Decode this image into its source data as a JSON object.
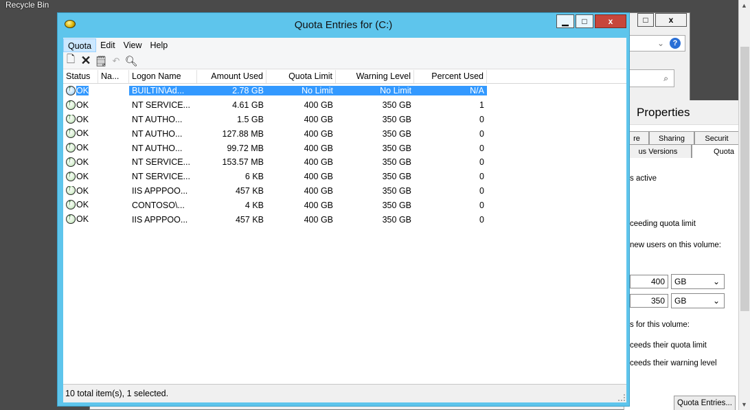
{
  "desktop": {
    "recycle_bin_label": "Recycle Bin"
  },
  "bg_window": {
    "min_label": "–",
    "max_label": "□",
    "close_label": "x",
    "address_dropdown": "⌄",
    "help_label": "?",
    "search_icon": "⌕"
  },
  "properties": {
    "title": "Properties",
    "tabs_row1": [
      "re",
      "Sharing",
      "Securit"
    ],
    "tabs_row2": [
      "us Versions",
      "Quota"
    ],
    "text_active": "s active",
    "text_exceeding": "ceeding quota limit",
    "text_new_users": "new users on this volume:",
    "limit_value": "400",
    "limit_unit": "GB",
    "warning_value": "350",
    "warning_unit": "GB",
    "text_for_volume": "s for this volume:",
    "text_exceeds_quota": "ceeds their quota limit",
    "text_exceeds_warning": "ceeds their warning level",
    "quota_entries_button": "Quota Entries..."
  },
  "quota_window": {
    "title": "Quota Entries for  (C:)",
    "minimize": "▁",
    "maximize": "□",
    "close": "x",
    "menu": [
      "Quota",
      "Edit",
      "View",
      "Help"
    ],
    "toolbar_icons": [
      "new-icon",
      "delete-icon",
      "properties-icon",
      "undo-icon",
      "find-icon"
    ],
    "columns": [
      "Status",
      "Na...",
      "Logon Name",
      "Amount Used",
      "Quota Limit",
      "Warning Level",
      "Percent Used"
    ],
    "rows": [
      {
        "status": "OK",
        "name": "",
        "logon": "BUILTIN\\Ad...",
        "amount": "2.78 GB",
        "limit": "No Limit",
        "warning": "No Limit",
        "percent": "N/A",
        "selected": true
      },
      {
        "status": "OK",
        "name": "",
        "logon": "NT SERVICE...",
        "amount": "4.61 GB",
        "limit": "400 GB",
        "warning": "350 GB",
        "percent": "1"
      },
      {
        "status": "OK",
        "name": "",
        "logon": "NT AUTHO...",
        "amount": "1.5 GB",
        "limit": "400 GB",
        "warning": "350 GB",
        "percent": "0"
      },
      {
        "status": "OK",
        "name": "",
        "logon": "NT AUTHO...",
        "amount": "127.88 MB",
        "limit": "400 GB",
        "warning": "350 GB",
        "percent": "0"
      },
      {
        "status": "OK",
        "name": "",
        "logon": "NT AUTHO...",
        "amount": "99.72 MB",
        "limit": "400 GB",
        "warning": "350 GB",
        "percent": "0"
      },
      {
        "status": "OK",
        "name": "",
        "logon": "NT SERVICE...",
        "amount": "153.57 MB",
        "limit": "400 GB",
        "warning": "350 GB",
        "percent": "0"
      },
      {
        "status": "OK",
        "name": "",
        "logon": "NT SERVICE...",
        "amount": "6 KB",
        "limit": "400 GB",
        "warning": "350 GB",
        "percent": "0"
      },
      {
        "status": "OK",
        "name": "",
        "logon": "IIS APPPOO...",
        "amount": "457 KB",
        "limit": "400 GB",
        "warning": "350 GB",
        "percent": "0"
      },
      {
        "status": "OK",
        "name": "",
        "logon": "CONTOSO\\...",
        "amount": "4 KB",
        "limit": "400 GB",
        "warning": "350 GB",
        "percent": "0"
      },
      {
        "status": "OK",
        "name": "",
        "logon": "IIS APPPOO...",
        "amount": "457 KB",
        "limit": "400 GB",
        "warning": "350 GB",
        "percent": "0"
      }
    ],
    "status_text": "10 total item(s), 1 selected."
  }
}
